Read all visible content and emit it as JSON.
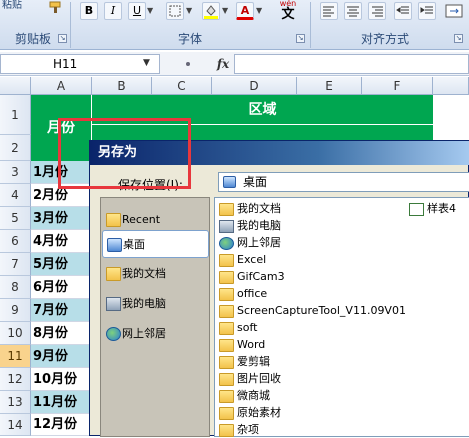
{
  "ribbon": {
    "paste_label": "粘贴",
    "clipboard_group": "剪贴板",
    "font_group": "字体",
    "align_group": "对齐方式",
    "bold": "B",
    "italic": "I",
    "underline": "U",
    "font_color_glyph": "A",
    "wen_glyph": "wén",
    "wen_char": "文"
  },
  "formula_bar": {
    "name_box": "H11",
    "fx": "fx"
  },
  "columns": [
    "A",
    "B",
    "C",
    "D",
    "E",
    "F"
  ],
  "rows": [
    "1",
    "2",
    "3",
    "4",
    "5",
    "6",
    "7",
    "8",
    "9",
    "10",
    "11",
    "12",
    "13",
    "14"
  ],
  "header": {
    "month": "月份",
    "region": "区域"
  },
  "months": [
    "1月份",
    "2月份",
    "3月份",
    "4月份",
    "5月份",
    "6月份",
    "7月份",
    "8月份",
    "9月份",
    "10月份",
    "11月份",
    "12月份"
  ],
  "dialog": {
    "title": "另存为",
    "save_in_label": "保存位置(I):",
    "save_in_value": "桌面",
    "places": [
      "Recent",
      "桌面",
      "我的文档",
      "我的电脑",
      "网上邻居"
    ],
    "files": [
      {
        "name": "我的文档",
        "icon": "my-documents-icon"
      },
      {
        "name": "我的电脑",
        "icon": "my-computer-icon"
      },
      {
        "name": "网上邻居",
        "icon": "network-icon"
      },
      {
        "name": "Excel",
        "icon": "folder-icon"
      },
      {
        "name": "GifCam3",
        "icon": "folder-icon"
      },
      {
        "name": "office",
        "icon": "folder-icon"
      },
      {
        "name": "ScreenCaptureTool_V11.09V01",
        "icon": "folder-icon"
      },
      {
        "name": "soft",
        "icon": "folder-icon"
      },
      {
        "name": "Word",
        "icon": "folder-icon"
      },
      {
        "name": "爱剪辑",
        "icon": "folder-icon"
      },
      {
        "name": "图片回收",
        "icon": "folder-icon"
      },
      {
        "name": "微商城",
        "icon": "folder-icon"
      },
      {
        "name": "原始素材",
        "icon": "folder-icon"
      },
      {
        "name": "杂项",
        "icon": "folder-icon"
      }
    ],
    "side_file": "样表4"
  },
  "colors": {
    "header_green": "#00a650",
    "month_blue": "#b7dee8",
    "highlight_red": "#e8373d"
  }
}
